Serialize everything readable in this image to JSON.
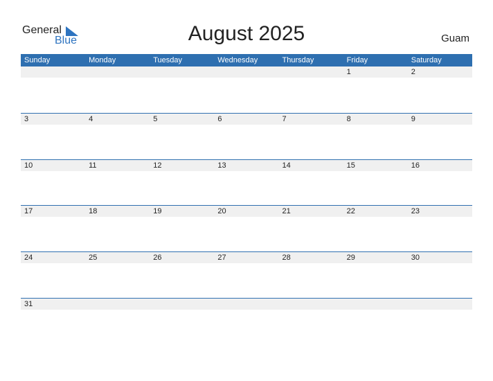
{
  "logo": {
    "general": "General",
    "blue": "Blue",
    "accent": "#2e74c0"
  },
  "title": "August 2025",
  "region": "Guam",
  "header_color": "#2e6fb0",
  "weekdays": [
    "Sunday",
    "Monday",
    "Tuesday",
    "Wednesday",
    "Thursday",
    "Friday",
    "Saturday"
  ],
  "weeks": [
    [
      "",
      "",
      "",
      "",
      "",
      "1",
      "2"
    ],
    [
      "3",
      "4",
      "5",
      "6",
      "7",
      "8",
      "9"
    ],
    [
      "10",
      "11",
      "12",
      "13",
      "14",
      "15",
      "16"
    ],
    [
      "17",
      "18",
      "19",
      "20",
      "21",
      "22",
      "23"
    ],
    [
      "24",
      "25",
      "26",
      "27",
      "28",
      "29",
      "30"
    ],
    [
      "31",
      "",
      "",
      "",
      "",
      "",
      ""
    ]
  ]
}
